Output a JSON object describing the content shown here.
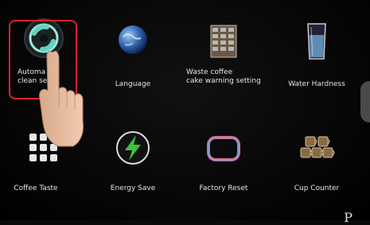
{
  "menu": {
    "items": [
      {
        "id": "auto-clean",
        "label_line1": "Automa",
        "label_line2": "clean se",
        "icon": "auto-clean-icon"
      },
      {
        "id": "language",
        "label_line1": "Language",
        "label_line2": "",
        "icon": "globe-icon"
      },
      {
        "id": "waste-coffee",
        "label_line1": "Waste coffee",
        "label_line2": "cake warning setting",
        "icon": "coffee-grounds-box-icon"
      },
      {
        "id": "water-hardness",
        "label_line1": "Water Hardness",
        "label_line2": "",
        "icon": "water-glass-icon"
      },
      {
        "id": "coffee-taste",
        "label_line1": "Coffee Taste",
        "label_line2": "",
        "icon": "grid-dots-icon"
      },
      {
        "id": "energy-save",
        "label_line1": "Energy Save",
        "label_line2": "",
        "icon": "lightning-bolt-icon"
      },
      {
        "id": "factory-reset",
        "label_line1": "Factory Reset",
        "label_line2": "",
        "icon": "reset-frame-icon"
      },
      {
        "id": "cup-counter",
        "label_line1": "Cup Counter",
        "label_line2": "",
        "icon": "cups-icon"
      }
    ]
  },
  "colors": {
    "background": "#0a0a0a",
    "highlight": "#d8202a",
    "label": "#e6e6e6",
    "energy_green": "#3fbf3f",
    "teal": "#5fd3c0"
  },
  "overlay": {
    "hand_icon": "pointing-hand-icon",
    "corner_glyph": "P"
  }
}
